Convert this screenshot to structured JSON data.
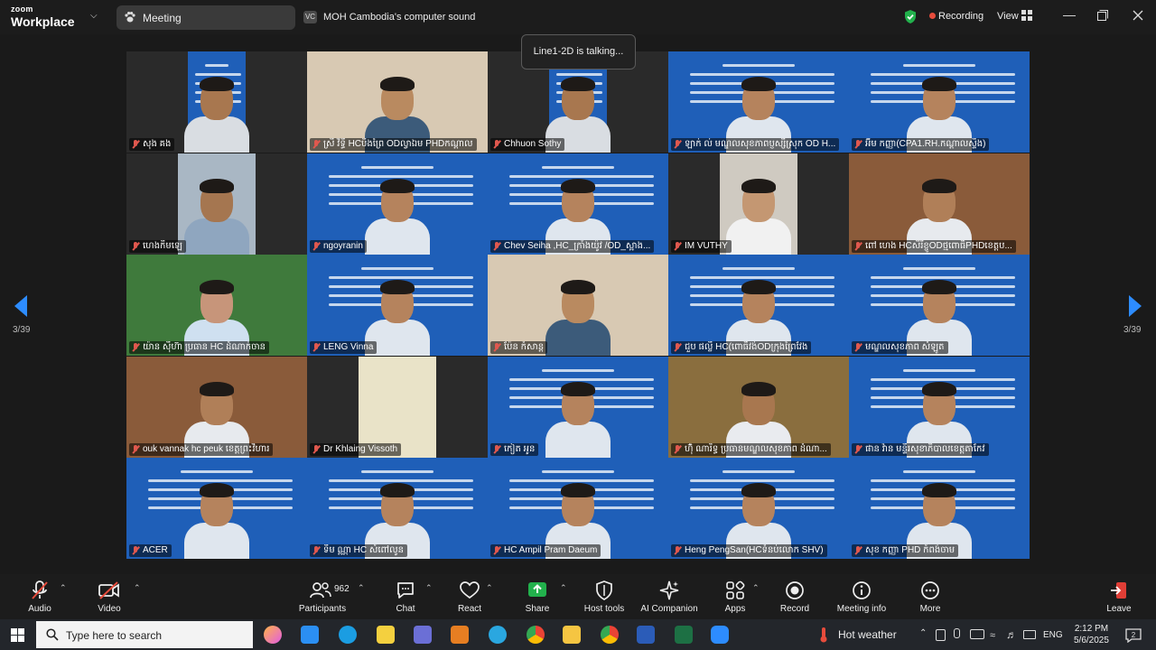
{
  "app": {
    "logo_line1": "zoom",
    "logo_line2": "Workplace",
    "meeting_tab": "Meeting",
    "audio_badge": "VC",
    "audio_source": "MOH Cambodia's computer sound",
    "recording": "Recording",
    "view": "View"
  },
  "talking_indicator": "Line1-2D is talking...",
  "pagination": {
    "left": "3/39",
    "right": "3/39"
  },
  "participants": [
    {
      "name": "សុង គង",
      "scene": "poster-narrow"
    },
    {
      "name": "ស្រី វិទ្ធី HCបឹងព្រៃ ODល្វាឯម PHDកណ្ដាល",
      "scene": "room"
    },
    {
      "name": "Chhuon Sothy",
      "scene": "poster-narrow"
    },
    {
      "name": "ឡាក់ ល់ មណ្ឌលសុខភាពប្ញស្សីស្រុក OD H...",
      "scene": "poster"
    },
    {
      "name": "អ៊ីម កញ្ញា(CPA1.RH.កណ្ដាលស្ទឹង)",
      "scene": "poster"
    },
    {
      "name": "ហេងកឹមឡេ",
      "scene": "portrait"
    },
    {
      "name": "ngoyranin",
      "scene": "poster"
    },
    {
      "name": "Chev Seiha ,HC_ក្រាំងយ៉ូវ /OD_ស្អាង...",
      "scene": "poster"
    },
    {
      "name": "IM VUTHY",
      "scene": "kitchen"
    },
    {
      "name": "ពៅ ហេង HCសិរីខ្ចូODថ្មពោធិ៍PHDខេត្តប...",
      "scene": "office"
    },
    {
      "name": "យ៉ាន ស៊ីហ៊ា ប្រធាន HC ដំណាក់ចាន",
      "scene": "green"
    },
    {
      "name": "LENG Vinna",
      "scene": "poster"
    },
    {
      "name": "ប៉ែន កំសាន្ត",
      "scene": "room"
    },
    {
      "name": "ជួប ផល្លី HC(ពោធិ៍វង់ODក្រុងព្រៃវែង",
      "scene": "poster"
    },
    {
      "name": "មណ្ឌលសុខភាព សំឡូត",
      "scene": "poster"
    },
    {
      "name": "ouk vannak hc peuk ខេត្តព្រះវិហារ",
      "scene": "office"
    },
    {
      "name": "Dr Khlaing Vissoth",
      "scene": "curtain"
    },
    {
      "name": "កៀត អូន",
      "scene": "poster"
    },
    {
      "name": "ហ៊ុំ ណារិទ្ធ ប្រធានមណ្ឌលសុខភាព ដំណា...",
      "scene": "banner"
    },
    {
      "name": "ផាន វ៉ាន មន្ទីរសុខាភិបាលខេត្តតាកែវ",
      "scene": "poster"
    },
    {
      "name": "ACER",
      "scene": "poster"
    },
    {
      "name": "ទឹម ណ្ណា HC សំពៅលូន",
      "scene": "poster"
    },
    {
      "name": "HC Ampil Pram Daeum",
      "scene": "poster"
    },
    {
      "name": "Heng PengSan(HCទំនប់លោក SHV)",
      "scene": "poster"
    },
    {
      "name": "សុខ កញ្ញា PHD កំពង់ចាម",
      "scene": "poster"
    }
  ],
  "controls": {
    "audio": "Audio",
    "video": "Video",
    "participants": "Participants",
    "participants_count": "962",
    "chat": "Chat",
    "react": "React",
    "share": "Share",
    "host_tools": "Host tools",
    "ai_companion": "AI Companion",
    "apps": "Apps",
    "record": "Record",
    "meeting_info": "Meeting info",
    "more": "More",
    "leave": "Leave"
  },
  "taskbar": {
    "search_placeholder": "Type here to search",
    "weather": "Hot weather",
    "language": "ENG",
    "time": "2:12 PM",
    "date": "5/6/2025",
    "notifications": "2"
  },
  "colors": {
    "poster_blue": "#1f5fb8",
    "share_green": "#22b14c",
    "leave_red": "#e03e36",
    "record_red": "#e74c3c"
  }
}
